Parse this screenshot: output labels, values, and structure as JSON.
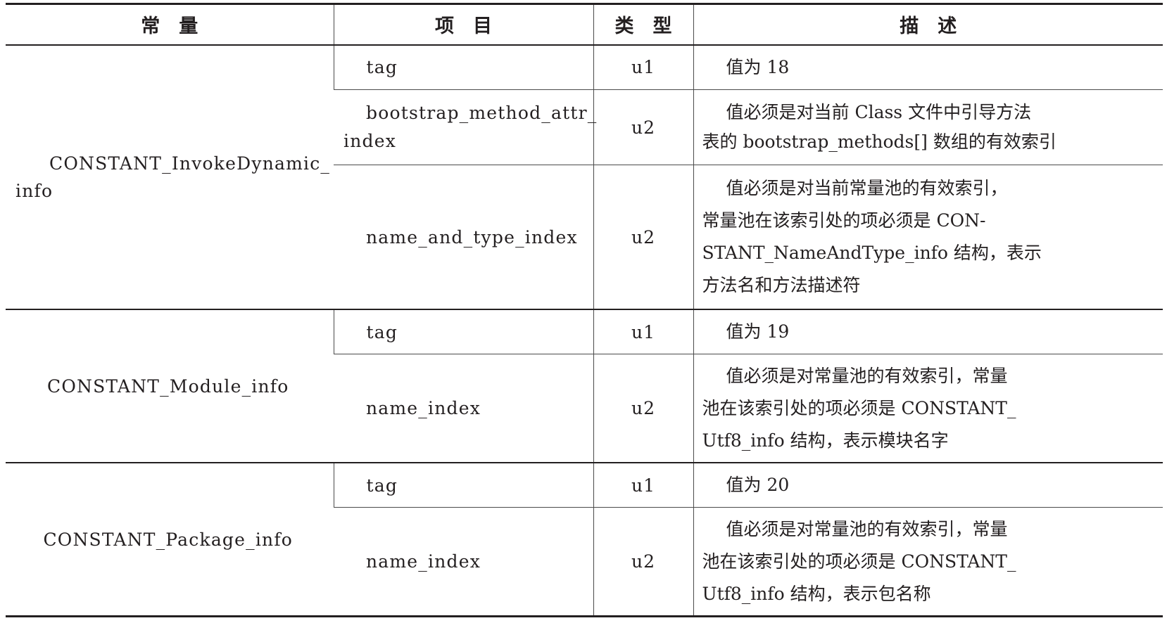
{
  "header": {
    "constant": "常　量",
    "item": "项　目",
    "type": "类　型",
    "description": "描　述"
  },
  "groups": [
    {
      "constant_line1": "CONSTANT_InvokeDynamic_",
      "constant_line2": "info",
      "rows": [
        {
          "item": "tag",
          "type": "u1",
          "desc": "值为 18"
        },
        {
          "item_line1": "bootstrap_method_attr_",
          "item_line2": "index",
          "type": "u2",
          "desc_line1": "值必须是对当前 Class 文件中引导方法",
          "desc_line2": "表的 bootstrap_methods[] 数组的有效索引"
        },
        {
          "item": "name_and_type_index",
          "type": "u2",
          "desc_line1": "值必须是对当前常量池的有效索引，",
          "desc_line2": "常量池在该索引处的项必须是 CON-",
          "desc_line3": "STANT_NameAndType_info 结构，表示",
          "desc_line4": "方法名和方法描述符"
        }
      ]
    },
    {
      "constant": "CONSTANT_Module_info",
      "rows": [
        {
          "item": "tag",
          "type": "u1",
          "desc": "值为 19"
        },
        {
          "item": "name_index",
          "type": "u2",
          "desc_line1": "值必须是对常量池的有效索引，常量",
          "desc_line2": "池在该索引处的项必须是 CONSTANT_",
          "desc_line3": "Utf8_info 结构，表示模块名字"
        }
      ]
    },
    {
      "constant": "CONSTANT_Package_info",
      "rows": [
        {
          "item": "tag",
          "type": "u1",
          "desc": "值为 20"
        },
        {
          "item": "name_index",
          "type": "u2",
          "desc_line1": "值必须是对常量池的有效索引，常量",
          "desc_line2": "池在该索引处的项必须是 CONSTANT_",
          "desc_line3": "Utf8_info 结构，表示包名称"
        }
      ]
    }
  ]
}
